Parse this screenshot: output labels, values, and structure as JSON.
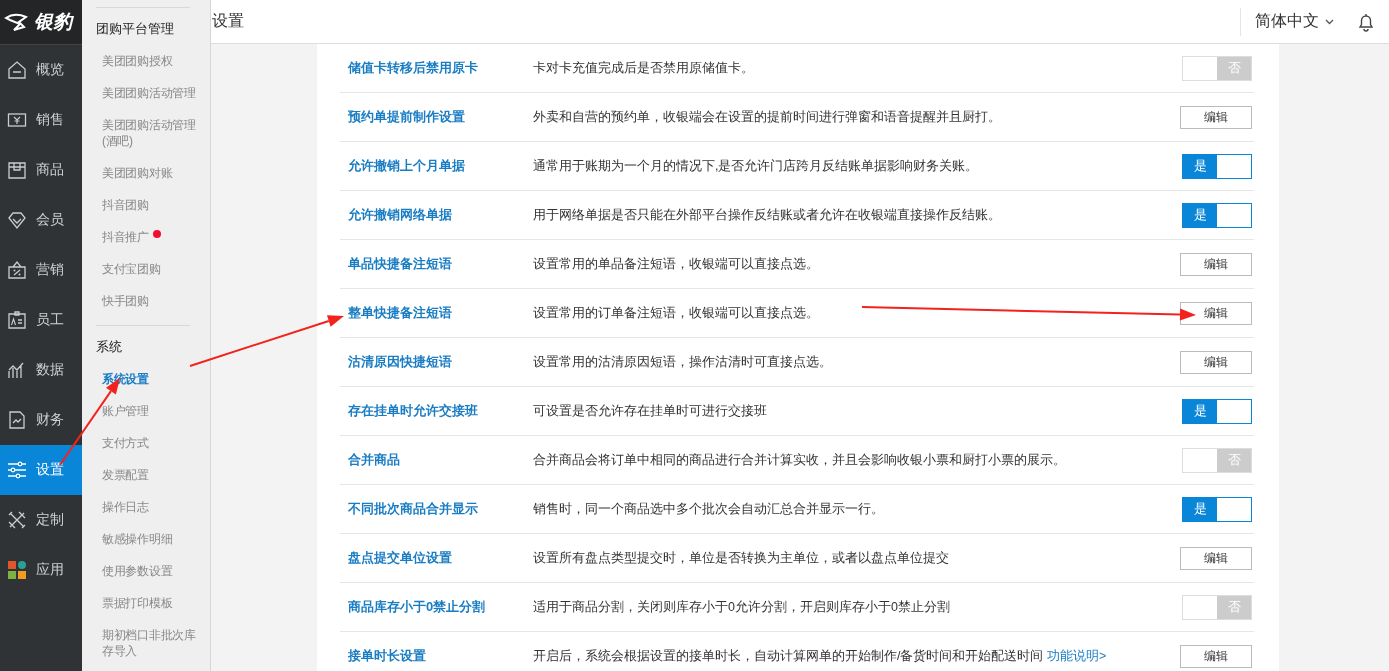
{
  "logo": {
    "text": "银豹"
  },
  "rail": [
    {
      "label": "概览",
      "selected": false
    },
    {
      "label": "销售",
      "selected": false
    },
    {
      "label": "商品",
      "selected": false
    },
    {
      "label": "会员",
      "selected": false
    },
    {
      "label": "营销",
      "selected": false
    },
    {
      "label": "员工",
      "selected": false
    },
    {
      "label": "数据",
      "selected": false
    },
    {
      "label": "财务",
      "selected": false
    },
    {
      "label": "设置",
      "selected": true
    },
    {
      "label": "定制",
      "selected": false
    },
    {
      "label": "应用",
      "selected": false
    }
  ],
  "submenu": [
    {
      "title": "团购平台管理",
      "items": [
        {
          "label": "美团团购授权",
          "selected": false,
          "dot": false
        },
        {
          "label": "美团团购活动管理",
          "selected": false,
          "dot": false
        },
        {
          "label": "美团团购活动管理(酒吧)",
          "selected": false,
          "dot": false
        },
        {
          "label": "美团团购对账",
          "selected": false,
          "dot": false
        },
        {
          "label": "抖音团购",
          "selected": false,
          "dot": false
        },
        {
          "label": "抖音推广",
          "selected": false,
          "dot": true
        },
        {
          "label": "支付宝团购",
          "selected": false,
          "dot": false
        },
        {
          "label": "快手团购",
          "selected": false,
          "dot": false
        }
      ]
    },
    {
      "title": "系统",
      "items": [
        {
          "label": "系统设置",
          "selected": true,
          "dot": false
        },
        {
          "label": "账户管理",
          "selected": false,
          "dot": false
        },
        {
          "label": "支付方式",
          "selected": false,
          "dot": false
        },
        {
          "label": "发票配置",
          "selected": false,
          "dot": false
        },
        {
          "label": "操作日志",
          "selected": false,
          "dot": false
        },
        {
          "label": "敏感操作明细",
          "selected": false,
          "dot": false
        },
        {
          "label": "使用参数设置",
          "selected": false,
          "dot": false
        },
        {
          "label": "票据打印模板",
          "selected": false,
          "dot": false
        },
        {
          "label": "期初档口非批次库存导入",
          "selected": false,
          "dot": false
        }
      ]
    }
  ],
  "header": {
    "title": "设置",
    "language": "简体中文"
  },
  "settings": [
    {
      "name": "储值卡转移后禁用原卡",
      "description": "卡对卡充值完成后是否禁用原储值卡。",
      "kind": "toggle",
      "on": false,
      "label": "否"
    },
    {
      "name": "预约单提前制作设置",
      "description": "外卖和自营的预约单，收银端会在设置的提前时间进行弹窗和语音提醒并且厨打。",
      "kind": "button",
      "button": "编辑"
    },
    {
      "name": "允许撤销上个月单据",
      "description": "通常用于账期为一个月的情况下,是否允许门店跨月反结账单据影响财务关账。",
      "kind": "toggle",
      "on": true,
      "label": "是"
    },
    {
      "name": "允许撤销网络单据",
      "description": "用于网络单据是否只能在外部平台操作反结账或者允许在收银端直接操作反结账。",
      "kind": "toggle",
      "on": true,
      "label": "是"
    },
    {
      "name": "单品快捷备注短语",
      "description": "设置常用的单品备注短语，收银端可以直接点选。",
      "kind": "button",
      "button": "编辑"
    },
    {
      "name": "整单快捷备注短语",
      "description": "设置常用的订单备注短语，收银端可以直接点选。",
      "kind": "button",
      "button": "编辑"
    },
    {
      "name": "沽清原因快捷短语",
      "description": "设置常用的沽清原因短语，操作沽清时可直接点选。",
      "kind": "button",
      "button": "编辑"
    },
    {
      "name": "存在挂单时允许交接班",
      "description": "可设置是否允许存在挂单时可进行交接班",
      "kind": "toggle",
      "on": true,
      "label": "是"
    },
    {
      "name": "合并商品",
      "description": "合并商品会将订单中相同的商品进行合并计算实收，并且会影响收银小票和厨打小票的展示。",
      "kind": "toggle",
      "on": false,
      "label": "否"
    },
    {
      "name": "不同批次商品合并显示",
      "description": "销售时，同一个商品选中多个批次会自动汇总合并显示一行。",
      "kind": "toggle",
      "on": true,
      "label": "是"
    },
    {
      "name": "盘点提交单位设置",
      "description": "设置所有盘点类型提交时，单位是否转换为主单位，或者以盘点单位提交",
      "kind": "button",
      "button": "编辑"
    },
    {
      "name": "商品库存小于0禁止分割",
      "description": "适用于商品分割，关闭则库存小于0允许分割，开启则库存小于0禁止分割",
      "kind": "toggle",
      "on": false,
      "label": "否"
    },
    {
      "name": "接单时长设置",
      "description": "开启后，系统会根据设置的接单时长，自动计算网单的开始制作/备货时间和开始配送时间",
      "link": "功能说明>",
      "kind": "button",
      "button": "编辑"
    }
  ],
  "annotations": [
    {
      "kind": "arrow"
    },
    {
      "kind": "arrow"
    },
    {
      "kind": "arrow"
    }
  ]
}
